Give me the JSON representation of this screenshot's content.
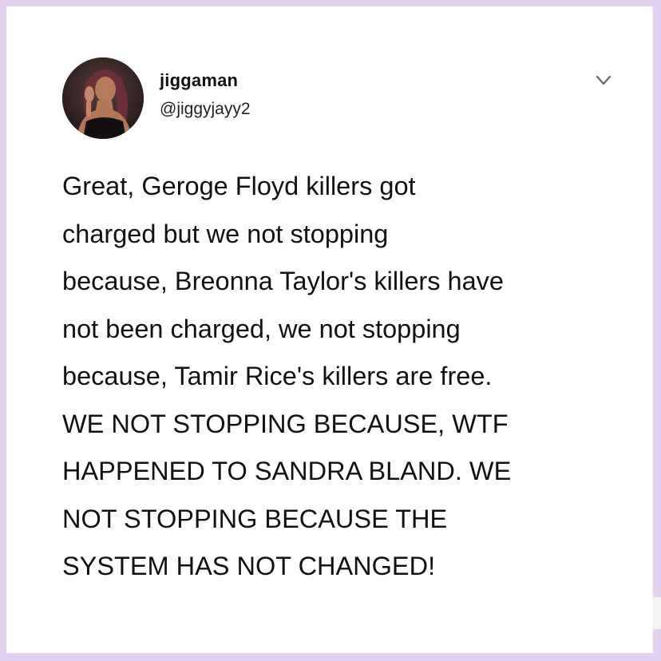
{
  "author": {
    "display_name": "jiggaman",
    "handle": "@jiggyjayy2",
    "avatar_icon": "profile-photo"
  },
  "menu": {
    "icon": "chevron-down-icon"
  },
  "tweet": {
    "lines": [
      "Great, Geroge Floyd killers got",
      "charged but we not stopping",
      "because, Breonna Taylor's killers have",
      "not been charged, we not stopping",
      "because, Tamir Rice's killers are free.",
      "WE NOT STOPPING BECAUSE, WTF",
      "HAPPENED TO SANDRA BLAND. WE",
      "NOT STOPPING BECAUSE THE",
      "SYSTEM HAS NOT CHANGED!"
    ]
  },
  "colors": {
    "frame_border": "#e2d2ef",
    "background": "#ffffff",
    "text": "#111111"
  }
}
